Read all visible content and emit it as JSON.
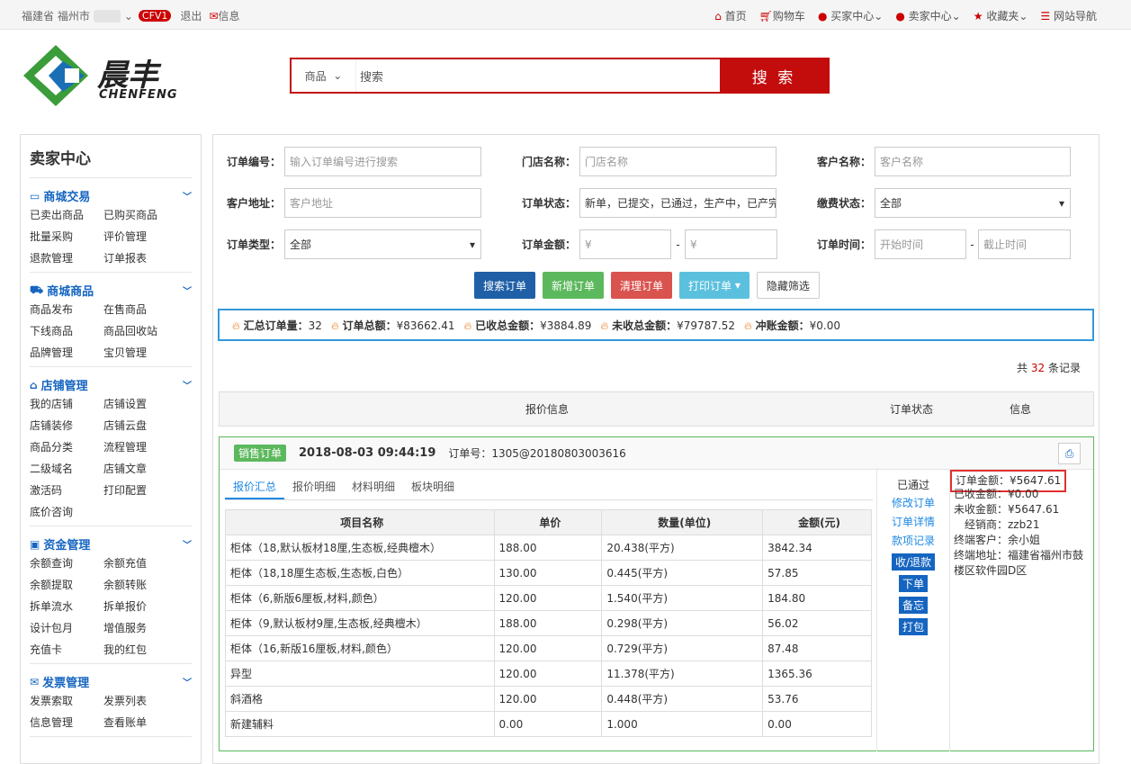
{
  "topbar": {
    "location": "福建省 福州市",
    "cfv": "CFV1",
    "logout": "退出",
    "message": "信息",
    "nav": [
      {
        "icon": "home-icon",
        "label": "首页"
      },
      {
        "icon": "cart-icon",
        "label": "购物车"
      },
      {
        "icon": "user-icon",
        "label": "买家中心"
      },
      {
        "icon": "user-icon",
        "label": "卖家中心"
      },
      {
        "icon": "star-icon",
        "label": "收藏夹"
      },
      {
        "icon": "list-icon",
        "label": "网站导航"
      }
    ]
  },
  "logo": {
    "cn": "晨丰",
    "en": "CHENFENG"
  },
  "search": {
    "category": "商品",
    "placeholder": "搜索",
    "button": "搜 索"
  },
  "sidebar": {
    "title": "卖家中心",
    "sections": [
      {
        "title": "商城交易",
        "icon": "card-icon",
        "items": [
          "已卖出商品",
          "已购买商品",
          "批量采购",
          "评价管理",
          "退款管理",
          "订单报表"
        ]
      },
      {
        "title": "商城商品",
        "icon": "truck-icon",
        "items": [
          "商品发布",
          "在售商品",
          "下线商品",
          "商品回收站",
          "品牌管理",
          "宝贝管理"
        ]
      },
      {
        "title": "店铺管理",
        "icon": "home-icon",
        "items": [
          "我的店铺",
          "店铺设置",
          "店铺装修",
          "店铺云盘",
          "商品分类",
          "流程管理",
          "二级域名",
          "店铺文章",
          "激活码",
          "打印配置",
          "底价咨询"
        ]
      },
      {
        "title": "资金管理",
        "icon": "money-icon",
        "items": [
          "余额查询",
          "余额充值",
          "余额提取",
          "余额转账",
          "拆单流水",
          "拆单报价",
          "设计包月",
          "增值服务",
          "充值卡",
          "我的红包"
        ]
      },
      {
        "title": "发票管理",
        "icon": "mail-icon",
        "items": [
          "发票索取",
          "发票列表",
          "信息管理",
          "查看账单"
        ]
      }
    ]
  },
  "filters": {
    "order_no": "订单编号：",
    "order_no_ph": "输入订单编号进行搜索",
    "store": "门店名称：",
    "store_ph": "门店名称",
    "customer": "客户名称：",
    "customer_ph": "客户名称",
    "address": "客户地址：",
    "address_ph": "客户地址",
    "status": "订单状态：",
    "status_val": "新单，已提交，已通过，生产中，已产完",
    "pay": "缴费状态：",
    "pay_val": "全部",
    "type": "订单类型：",
    "type_val": "全部",
    "amount": "订单金额：",
    "amount_ph": "¥",
    "time": "订单时间：",
    "time_start": "开始时间",
    "time_end": "截止时间",
    "dash": "-"
  },
  "buttons": {
    "search": "搜索订单",
    "add": "新增订单",
    "clear": "清理订单",
    "print": "打印订单",
    "hide": "隐藏筛选"
  },
  "summary": [
    {
      "label": "汇总订单量：",
      "value": "32"
    },
    {
      "label": "订单总额：",
      "value": "¥83662.41"
    },
    {
      "label": "已收总金额：",
      "value": "¥3884.89"
    },
    {
      "label": "未收总金额：",
      "value": "¥79787.52"
    },
    {
      "label": "冲账金额：",
      "value": "¥0.00"
    }
  ],
  "total": {
    "pre": "共",
    "count": "32",
    "post": "条记录"
  },
  "thead": {
    "info": "报价信息",
    "status": "订单状态",
    "msg": "信息"
  },
  "order": {
    "tag": "销售订单",
    "time": "2018-08-03 09:44:19",
    "no": "订单号：1305@20180803003616",
    "tabs": [
      "报价汇总",
      "报价明细",
      "材料明细",
      "板块明细"
    ],
    "columns": [
      "项目名称",
      "单价",
      "数量(单位)",
      "金额(元)"
    ],
    "rows": [
      [
        "柜体（18,默认板材18厘,生态板,经典檀木）",
        "188.00",
        "20.438(平方)",
        "3842.34"
      ],
      [
        "柜体（18,18厘生态板,生态板,白色）",
        "130.00",
        "0.445(平方)",
        "57.85"
      ],
      [
        "柜体（6,新版6厘板,材料,颜色）",
        "120.00",
        "1.540(平方)",
        "184.80"
      ],
      [
        "柜体（9,默认板材9厘,生态板,经典檀木）",
        "188.00",
        "0.298(平方)",
        "56.02"
      ],
      [
        "柜体（16,新版16厘板,材料,颜色）",
        "120.00",
        "0.729(平方)",
        "87.48"
      ],
      [
        "异型",
        "120.00",
        "11.378(平方)",
        "1365.36"
      ],
      [
        "斜酒格",
        "120.00",
        "0.448(平方)",
        "53.76"
      ],
      [
        "新建辅料",
        "0.00",
        "1.000",
        "0.00"
      ]
    ],
    "status": "已通过",
    "links": [
      "修改订单",
      "订单详情",
      "款项记录"
    ],
    "actions": [
      "收/退款",
      "下单",
      "备忘",
      "打包"
    ],
    "info": {
      "amount": "订单金额：¥5647.61",
      "received": "已收金额：¥0.00",
      "unreceived": "未收金额：¥5647.61",
      "dealer": "经销商：zzb21",
      "customer": "终端客户：余小姐",
      "address": "终端地址：福建省福州市鼓楼区软件园D区"
    }
  },
  "colors": {
    "brand": "#c30d0d",
    "blue": "#1565c0",
    "green": "#5cb85c"
  }
}
